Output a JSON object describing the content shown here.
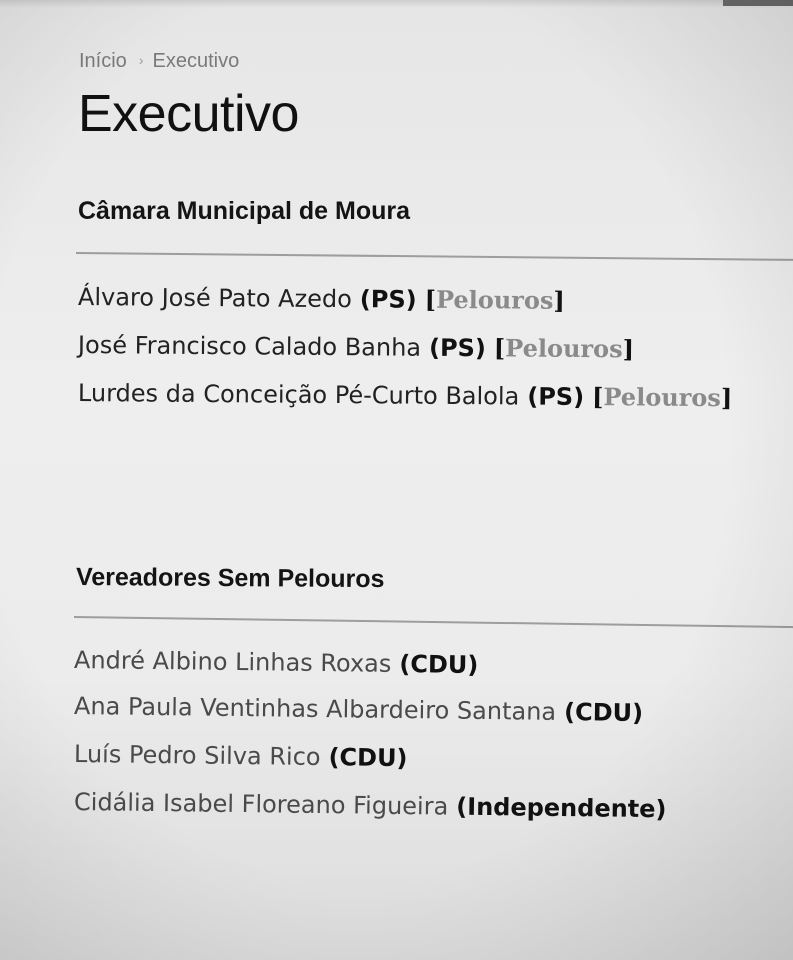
{
  "breadcrumb": {
    "home": "Início",
    "separator": "›",
    "current": "Executivo"
  },
  "page_title": "Executivo",
  "sections": [
    {
      "heading": "Câmara Municipal de Moura",
      "members": [
        {
          "name": "Álvaro José Pato Azedo",
          "party": "(PS)",
          "link_open": "[",
          "link_label": "Pelouros",
          "link_close": "]"
        },
        {
          "name": "José Francisco Calado Banha",
          "party": "(PS)",
          "link_open": "[",
          "link_label": "Pelouros",
          "link_close": "]"
        },
        {
          "name": "Lurdes da Conceição Pé-Curto Balola",
          "party": "(PS)",
          "link_open": "[",
          "link_label": "Pelouros",
          "link_close": "]"
        }
      ]
    },
    {
      "heading": "Vereadores Sem Pelouros",
      "members": [
        {
          "name": "André Albino Linhas Roxas",
          "party": "(CDU)"
        },
        {
          "name": "Ana Paula Ventinhas Albardeiro Santana",
          "party": "(CDU)"
        },
        {
          "name": "Luís Pedro Silva Rico",
          "party": "(CDU)"
        },
        {
          "name": "Cidália Isabel Floreano Figueira",
          "party": "(Independente)"
        }
      ]
    }
  ],
  "colors": {
    "link": "#8a8a8a",
    "breadcrumb": "#7a7a7a",
    "divider": "#9d9d9d"
  }
}
